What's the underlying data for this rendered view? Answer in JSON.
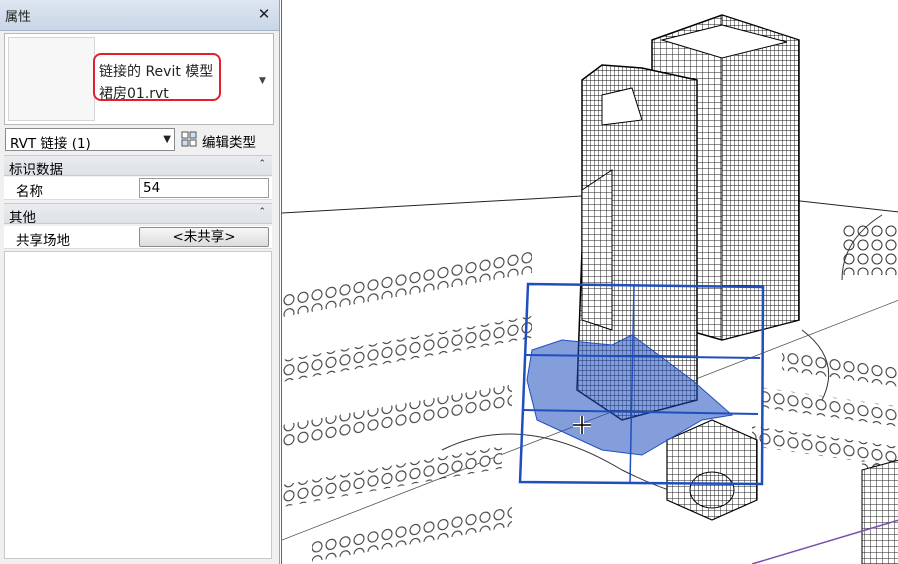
{
  "panel": {
    "title": "属性",
    "type_line1": "链接的 Revit 模型",
    "type_line2": "裙房01.rvt",
    "selector_value": "RVT 链接 (1)",
    "edit_type_label": "编辑类型",
    "groups": [
      {
        "label": "标识数据",
        "rows": [
          {
            "label": "名称",
            "value": "54"
          }
        ]
      },
      {
        "label": "其他",
        "rows": [
          {
            "label": "共享场地",
            "value": "<未共享>"
          }
        ]
      }
    ]
  },
  "colors": {
    "selection": "#1f4fbf",
    "highlight": "#e0202c"
  }
}
